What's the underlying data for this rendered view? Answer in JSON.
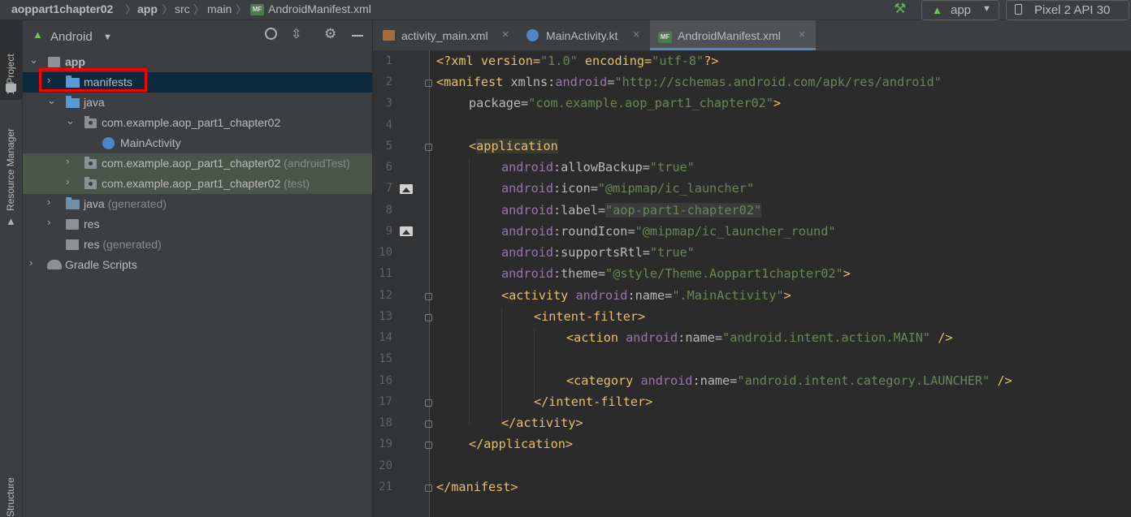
{
  "navbar": {
    "crumbs": [
      "aoppart1chapter02",
      "app",
      "src",
      "main",
      "AndroidManifest.xml"
    ],
    "run_config": "app",
    "device": "Pixel 2 API 30"
  },
  "stripe": {
    "project_label": "1: Project",
    "resource_label": "Resource Manager",
    "structure_label": "Structure"
  },
  "project": {
    "view_mode": "Android",
    "tree": [
      {
        "label": "app",
        "suffix": ""
      },
      {
        "label": "manifests",
        "suffix": ""
      },
      {
        "label": "java",
        "suffix": ""
      },
      {
        "label": "com.example.aop_part1_chapter02",
        "suffix": ""
      },
      {
        "label": "MainActivity",
        "suffix": ""
      },
      {
        "label": "com.example.aop_part1_chapter02",
        "suffix": "(androidTest)"
      },
      {
        "label": "com.example.aop_part1_chapter02",
        "suffix": "(test)"
      },
      {
        "label": "java",
        "suffix": "(generated)"
      },
      {
        "label": "res",
        "suffix": ""
      },
      {
        "label": "res",
        "suffix": "(generated)"
      },
      {
        "label": "Gradle Scripts",
        "suffix": ""
      }
    ]
  },
  "tabs": [
    {
      "label": "activity_main.xml"
    },
    {
      "label": "MainActivity.kt"
    },
    {
      "label": "AndroidManifest.xml"
    }
  ],
  "editor": {
    "line_numbers": [
      "1",
      "2",
      "3",
      "4",
      "5",
      "6",
      "7",
      "8",
      "9",
      "10",
      "11",
      "12",
      "13",
      "14",
      "15",
      "16",
      "17",
      "18",
      "19",
      "20",
      "21"
    ],
    "code": {
      "l1_a": "<?xml version=",
      "l1_b": "\"1.0\"",
      "l1_c": " encoding=",
      "l1_d": "\"utf-8\"",
      "l1_e": "?>",
      "l2_a": "<manifest ",
      "l2_b": "xmlns:",
      "l2_c": "android",
      "l2_d": "=",
      "l2_e": "\"http://schemas.android.com/apk/res/android\"",
      "l3_a": "package",
      "l3_b": "=",
      "l3_c": "\"com.example.aop_part1_chapter02\"",
      "l3_d": ">",
      "l5_a": "<",
      "l5_b": "application",
      "l6_ns": "android",
      "l6_attr": ":allowBackup",
      "l6_eq": "=",
      "l6_val": "\"true\"",
      "l7_ns": "android",
      "l7_attr": ":icon",
      "l7_eq": "=",
      "l7_val": "\"@mipmap/ic_launcher\"",
      "l8_ns": "android",
      "l8_attr": ":label",
      "l8_eq": "=",
      "l8_val": "\"aop-part1-chapter02\"",
      "l9_ns": "android",
      "l9_attr": ":roundIcon",
      "l9_eq": "=",
      "l9_val": "\"@mipmap/ic_launcher_round\"",
      "l10_ns": "android",
      "l10_attr": ":supportsRtl",
      "l10_eq": "=",
      "l10_val": "\"true\"",
      "l11_ns": "android",
      "l11_attr": ":theme",
      "l11_eq": "=",
      "l11_val": "\"@style/Theme.Aoppart1chapter02\"",
      "l11_end": ">",
      "l12_tag": "<activity ",
      "l12_ns": "android",
      "l12_attr": ":name",
      "l12_eq": "=",
      "l12_val": "\".MainActivity\"",
      "l12_end": ">",
      "l13_tag": "<intent-filter>",
      "l14_tag": "<action ",
      "l14_ns": "android",
      "l14_attr": ":name",
      "l14_eq": "=",
      "l14_val": "\"android.intent.action.MAIN\"",
      "l14_end": " />",
      "l16_tag": "<category ",
      "l16_ns": "android",
      "l16_attr": ":name",
      "l16_eq": "=",
      "l16_val": "\"android.intent.category.LAUNCHER\"",
      "l16_end": " />",
      "l17_tag": "</intent-filter>",
      "l18_tag": "</activity>",
      "l19_tag": "</application>",
      "l21_tag": "</manifest>"
    }
  }
}
